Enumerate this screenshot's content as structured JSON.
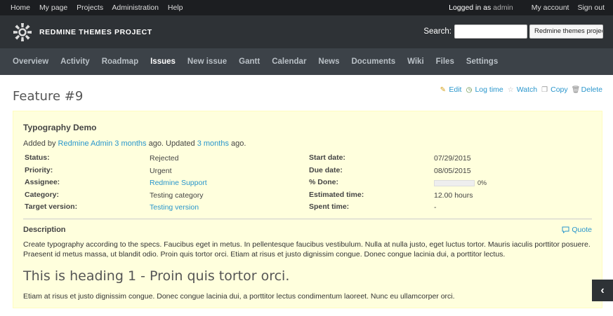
{
  "top_menu": {
    "items": [
      "Home",
      "My page",
      "Projects",
      "Administration",
      "Help"
    ],
    "logged_in_prefix": "Logged in as",
    "user": "admin",
    "my_account": "My account",
    "sign_out": "Sign out"
  },
  "header": {
    "title": "REDMINE THEMES PROJECT",
    "search_label": "Search:",
    "search_value": "",
    "project_select": "Redmine themes project"
  },
  "main_menu": {
    "tabs": [
      "Overview",
      "Activity",
      "Roadmap",
      "Issues",
      "New issue",
      "Gantt",
      "Calendar",
      "News",
      "Documents",
      "Wiki",
      "Files",
      "Settings"
    ],
    "selected": "Issues"
  },
  "contextual": {
    "edit": "Edit",
    "log_time": "Log time",
    "watch": "Watch",
    "copy": "Copy",
    "delete": "Delete"
  },
  "page_title": "Feature #9",
  "issue": {
    "subject": "Typography Demo",
    "added_by_prefix": "Added by",
    "author": "Redmine Admin",
    "created_ago": "3 months",
    "ago_updated": "ago. Updated",
    "updated_ago": "3 months",
    "ago_end": "ago.",
    "left_attrs": [
      {
        "label": "Status:",
        "value": "Rejected",
        "link": false
      },
      {
        "label": "Priority:",
        "value": "Urgent",
        "link": false
      },
      {
        "label": "Assignee:",
        "value": "Redmine Support",
        "link": true
      },
      {
        "label": "Category:",
        "value": "Testing category",
        "link": false
      },
      {
        "label": "Target version:",
        "value": "Testing version",
        "link": true
      }
    ],
    "right_attrs": [
      {
        "label": "Start date:",
        "value": "07/29/2015"
      },
      {
        "label": "Due date:",
        "value": "08/05/2015"
      },
      {
        "label": "% Done:",
        "value": "0%",
        "progress": 0
      },
      {
        "label": "Estimated time:",
        "value": "12.00 hours"
      },
      {
        "label": "Spent time:",
        "value": "-"
      }
    ],
    "description_label": "Description",
    "quote": "Quote",
    "description_p1": "Create typography according to the specs. Faucibus eget in metus. In pellentesque faucibus vestibulum. Nulla at nulla justo, eget luctus tortor. Mauris iaculis porttitor posuere. Praesent id metus massa, ut blandit odio. Proin quis tortor orci. Etiam at risus et justo dignissim congue. Donec congue lacinia dui, a porttitor lectus.",
    "heading1": "This is heading 1 - Proin quis tortor orci.",
    "description_p2": "Etiam at risus et justo dignissim congue. Donec congue lacinia dui, a porttitor lectus condimentum laoreet. Nunc eu ullamcorper orci."
  },
  "colors": {
    "top_bar": "#1c1e21",
    "header": "#2e3236",
    "main_menu": "#3c4248",
    "link": "#2996cc",
    "issue_bg": "#ffffdd"
  }
}
